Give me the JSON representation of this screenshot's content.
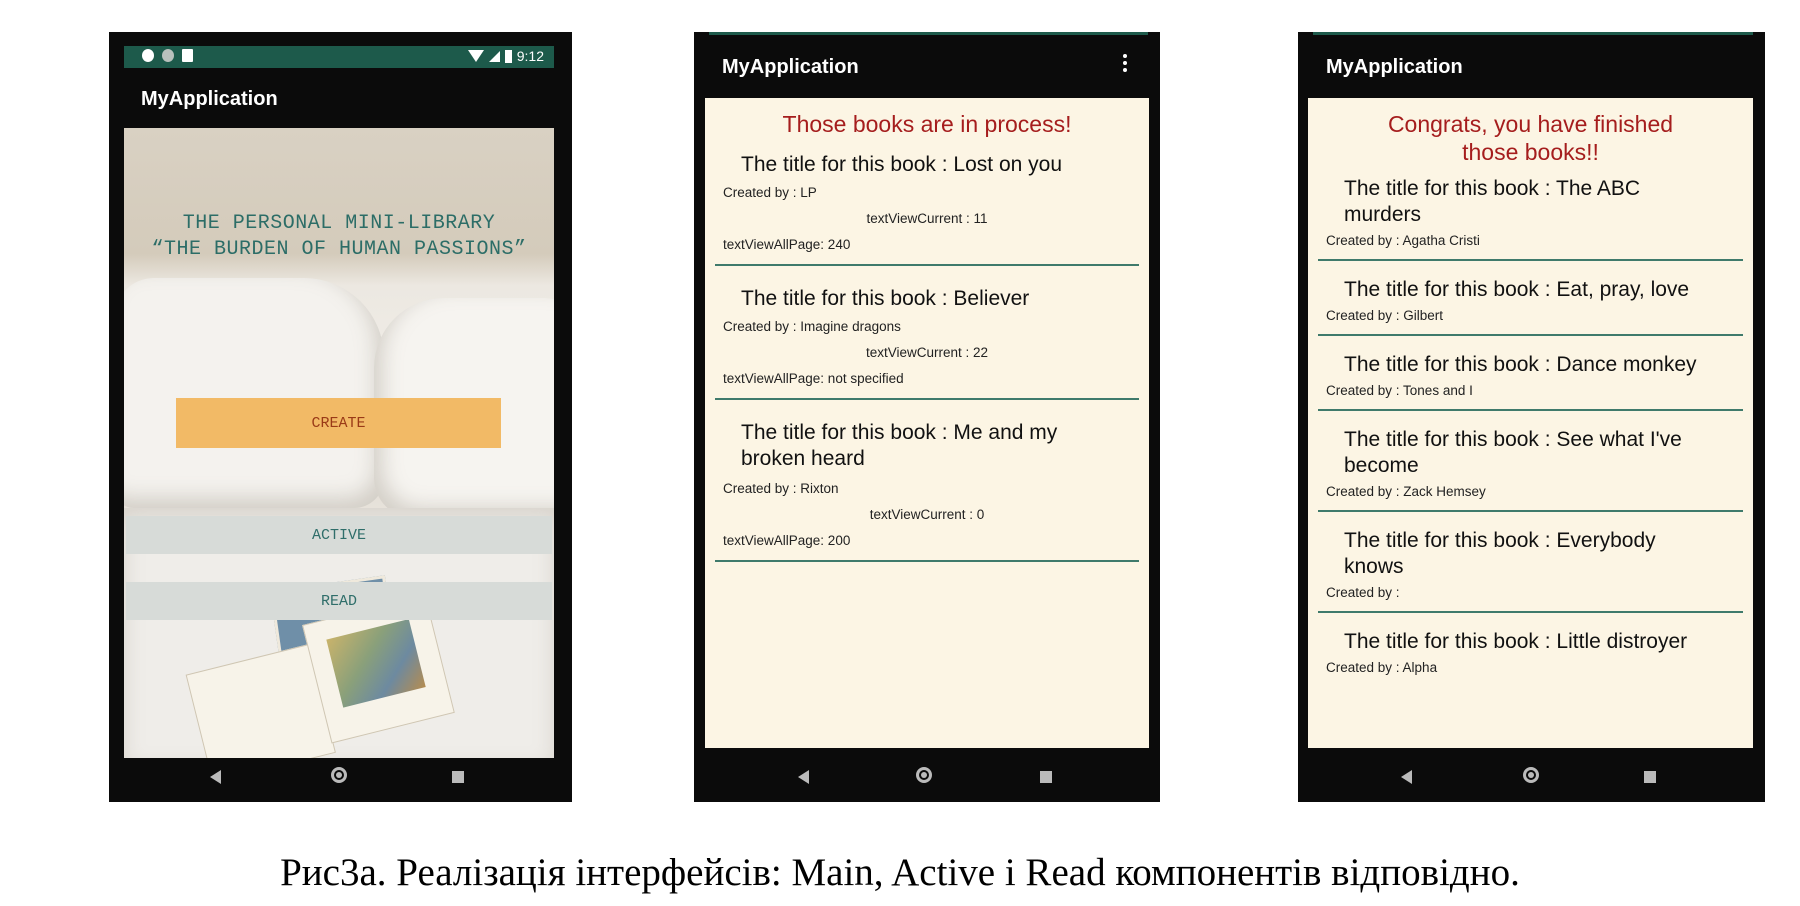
{
  "caption": "Рис3а. Реалізація інтерфейсів: Main, Active і Read компонентів відповідно.",
  "colors": {
    "status_bar": "#1d5a4b",
    "header_red": "#a51d1d",
    "divider_teal": "#3f7a6b",
    "list_background": "#fcf5e4",
    "create_button": "#f2ba66"
  },
  "phone_main": {
    "status_time": "9:12",
    "app_title": "MyApplication",
    "title_line1": "THE PERSONAL MINI-LIBRARY",
    "title_line2": "“THE BURDEN OF HUMAN PASSIONS”",
    "create_label": "CREATE",
    "active_label": "ACTIVE",
    "read_label": "READ"
  },
  "phone_active": {
    "app_title": "MyApplication",
    "header": "Those books are in process!",
    "items": [
      {
        "title": "The title for this book : Lost on you",
        "author": "Created by : LP",
        "current": "textViewCurrent : 11",
        "all_pages": "textViewAllPage: 240"
      },
      {
        "title": "The title for this book : Believer",
        "author": "Created by : Imagine dragons",
        "current": "textViewCurrent : 22",
        "all_pages": "textViewAllPage:  not specified"
      },
      {
        "title": "The title for this book : Me and my broken heard",
        "author": "Created by : Rixton",
        "current": "textViewCurrent : 0",
        "all_pages": "textViewAllPage: 200"
      }
    ]
  },
  "phone_read": {
    "app_title": "MyApplication",
    "header": "Congrats, you have finished those books!!",
    "items": [
      {
        "title": "The title for this book : The ABC murders",
        "author": "Created by : Agatha Cristi"
      },
      {
        "title": "The title for this book : Eat, pray, love",
        "author": "Created by : Gilbert"
      },
      {
        "title": "The title for this book : Dance monkey",
        "author": "Created by : Tones and I"
      },
      {
        "title": "The title for this book : See what I've become",
        "author": "Created by : Zack Hemsey"
      },
      {
        "title": "The title for this book : Everybody knows",
        "author": "Created by :"
      },
      {
        "title": "The title for this book : Little distroyer",
        "author": "Created by : Alpha"
      }
    ]
  }
}
